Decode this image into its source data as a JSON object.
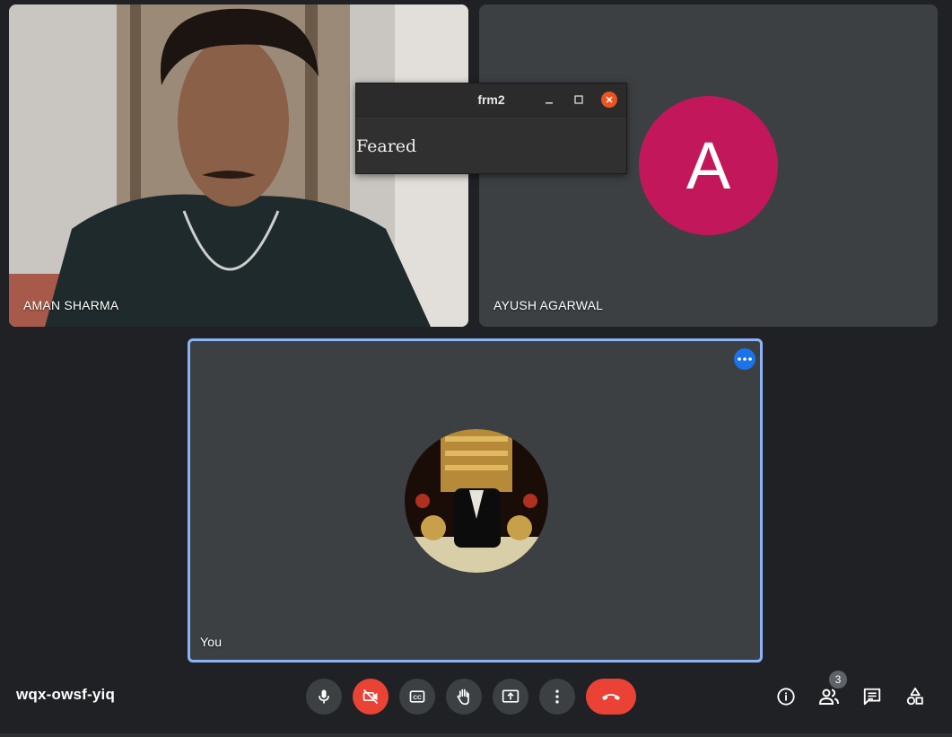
{
  "participants": [
    {
      "name": "AMAN SHARMA"
    },
    {
      "name": "AYUSH AGARWAL",
      "initial": "A",
      "avatar_color": "#c2185b"
    },
    {
      "name": "You"
    }
  ],
  "popup_window": {
    "title": "frm2",
    "text": "Feared"
  },
  "meeting_code": "wqx-owsf-yiq",
  "people_count": "3",
  "controls": [
    "mic-icon",
    "camera-off-icon",
    "captions-icon",
    "raise-hand-icon",
    "present-screen-icon",
    "more-options-icon",
    "hang-up-icon"
  ],
  "right_controls": [
    "info-icon",
    "people-icon",
    "chat-icon",
    "activities-icon"
  ],
  "colors": {
    "accent": "#8ab4f8",
    "danger": "#ea4335",
    "background": "#202124",
    "tile": "#3c4043"
  }
}
